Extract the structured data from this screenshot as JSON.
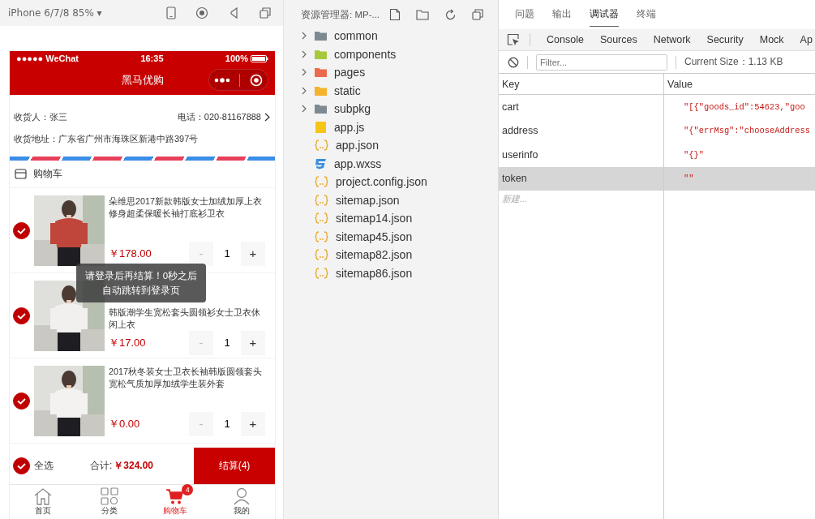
{
  "simulator": {
    "device": "iPhone 6/7/8 85% ▾"
  },
  "phone": {
    "status_bar": {
      "carrier": "●●●●● WeChat",
      "time": "16:35",
      "battery": "100%"
    },
    "nav_title": "黑马优购",
    "address": {
      "receiver": "收货人：张三",
      "phone": "电话：020-81167888",
      "detail": "收货地址：广东省广州市海珠区新港中路397号"
    },
    "cart_title": "购物车",
    "items": [
      {
        "title": "朵维思2017新款韩版女士加绒加厚上衣修身超柔保暖长袖打底衫卫衣",
        "price": "￥178.00",
        "quantity": "1",
        "minus": "-",
        "plus": "+",
        "checked": true
      },
      {
        "title": "韩版潮学生宽松套头圆领衫女士卫衣休闲上衣",
        "price": "￥17.00",
        "quantity": "1",
        "minus": "-",
        "plus": "+",
        "checked": true
      },
      {
        "title": "2017秋冬装女士卫衣长袖韩版圆领套头宽松气质加厚加绒学生装外套",
        "price": "￥0.00",
        "quantity": "1",
        "minus": "-",
        "plus": "+",
        "checked": true
      }
    ],
    "footer": {
      "select_all": "全选",
      "checked": true,
      "total_label": "合计:",
      "total": "￥324.00",
      "checkout": "结算(4)"
    },
    "toast": "请登录后再结算！0秒之后自动跳转到登录页",
    "tabbar": [
      {
        "kind": "home",
        "label": "首页",
        "selected": false
      },
      {
        "kind": "category",
        "label": "分类",
        "selected": false
      },
      {
        "kind": "cart",
        "label": "购物车",
        "selected": true,
        "badge": "4"
      },
      {
        "kind": "user",
        "label": "我的",
        "selected": false
      }
    ]
  },
  "explorer": {
    "title": "资源管理器: MP-...",
    "items": [
      {
        "kind": "folder",
        "name": "common",
        "color": "#7d8a92"
      },
      {
        "kind": "folder",
        "name": "components",
        "color": "#a8c83c"
      },
      {
        "kind": "folder",
        "name": "pages",
        "color": "#ec6a4c"
      },
      {
        "kind": "folder",
        "name": "static",
        "color": "#f4b32c"
      },
      {
        "kind": "folder",
        "name": "subpkg",
        "color": "#7d8a92"
      },
      {
        "kind": "js",
        "name": "app.js"
      },
      {
        "kind": "json",
        "name": "app.json"
      },
      {
        "kind": "css",
        "name": "app.wxss"
      },
      {
        "kind": "json",
        "name": "project.config.json"
      },
      {
        "kind": "json",
        "name": "sitemap.json"
      },
      {
        "kind": "json",
        "name": "sitemap14.json"
      },
      {
        "kind": "json",
        "name": "sitemap45.json"
      },
      {
        "kind": "json",
        "name": "sitemap82.json"
      },
      {
        "kind": "json",
        "name": "sitemap86.json"
      }
    ]
  },
  "devtools": {
    "tabs": [
      {
        "label": "问题",
        "selected": false
      },
      {
        "label": "输出",
        "selected": false
      },
      {
        "label": "调试器",
        "selected": true
      },
      {
        "label": "终端",
        "selected": false
      }
    ],
    "panels": [
      "Console",
      "Sources",
      "Network",
      "Security",
      "Mock",
      "Ap"
    ],
    "filter": {
      "placeholder": "Filter..."
    },
    "current_size": "Current Size：1.13 KB",
    "columns": [
      "Key",
      "Value"
    ],
    "rows": [
      {
        "key": "cart",
        "value": "\"[{\"goods_id\":54623,\"goo",
        "selected": false
      },
      {
        "key": "address",
        "value": "\"{\"errMsg\":\"chooseAddress",
        "selected": false
      },
      {
        "key": "userinfo",
        "value": "\"{}\"",
        "selected": false
      },
      {
        "key": "token",
        "value": "\"\"",
        "selected": true
      }
    ],
    "new_row_placeholder": "新建..."
  }
}
